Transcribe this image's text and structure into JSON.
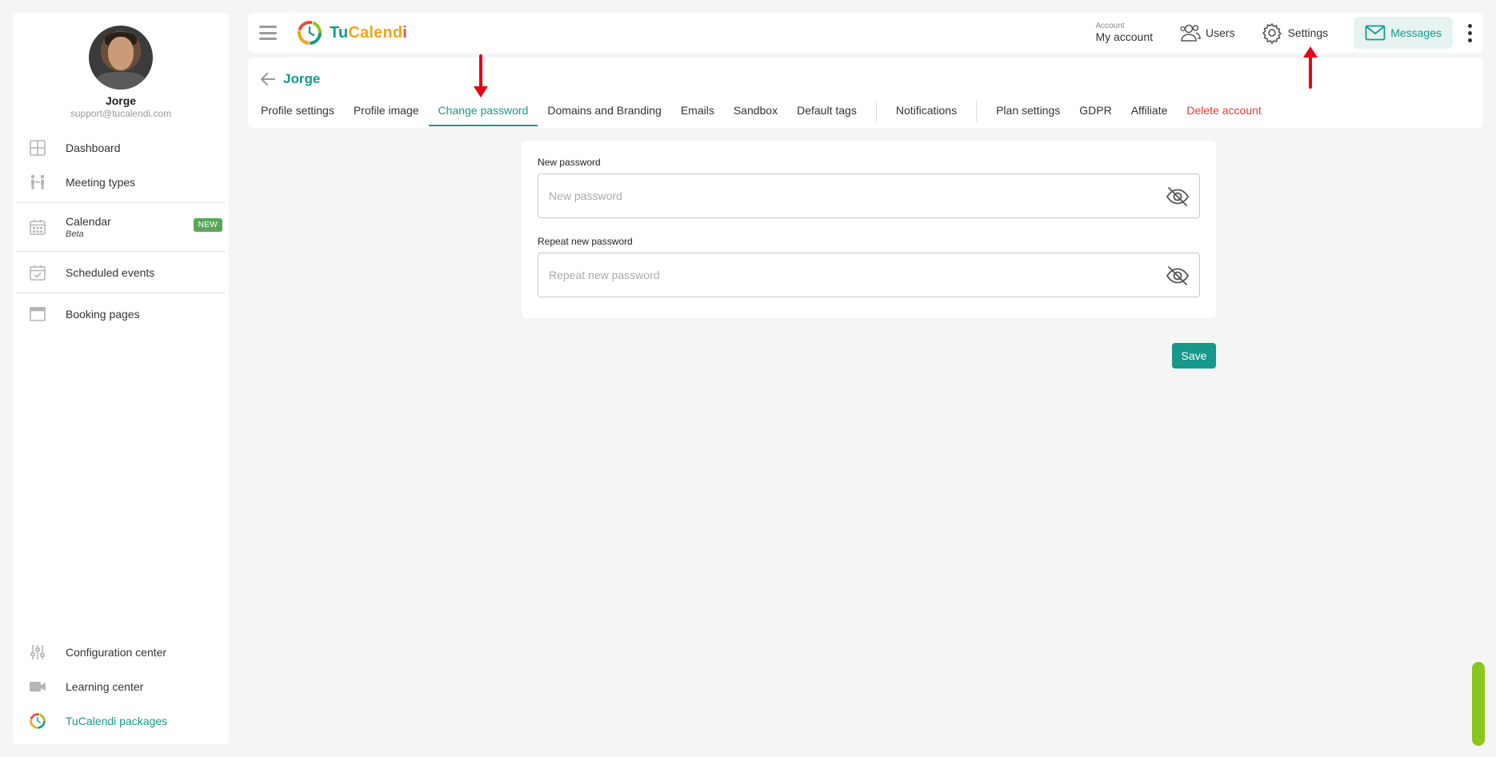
{
  "profile": {
    "name": "Jorge",
    "email": "support@tucalendi.com"
  },
  "sidebar": {
    "items": [
      {
        "label": "Dashboard"
      },
      {
        "label": "Meeting types"
      },
      {
        "label": "Calendar",
        "sub": "Beta",
        "badge": "NEW"
      },
      {
        "label": "Scheduled events"
      },
      {
        "label": "Booking pages"
      }
    ],
    "bottom": [
      {
        "label": "Configuration center"
      },
      {
        "label": "Learning center"
      },
      {
        "label": "TuCalendi packages"
      }
    ]
  },
  "topbar": {
    "logo_tu": "Tu",
    "logo_calend": "Calend",
    "logo_i": "i",
    "account_caption": "Account",
    "account_value": "My account",
    "users": "Users",
    "settings": "Settings",
    "messages": "Messages"
  },
  "header": {
    "name": "Jorge",
    "tabs": [
      "Profile settings",
      "Profile image",
      "Change password",
      "Domains and Branding",
      "Emails",
      "Sandbox",
      "Default tags",
      "Notifications",
      "Plan settings",
      "GDPR",
      "Affiliate",
      "Delete account"
    ]
  },
  "form": {
    "new_password_label": "New password",
    "new_password_placeholder": "New password",
    "repeat_password_label": "Repeat new password",
    "repeat_password_placeholder": "Repeat new password",
    "save": "Save"
  },
  "colors": {
    "accent": "#16998a",
    "danger": "#e53935",
    "badge": "#5aa75b",
    "annotation_arrow": "#e30613",
    "scroll_thumb": "#8bc61f"
  }
}
